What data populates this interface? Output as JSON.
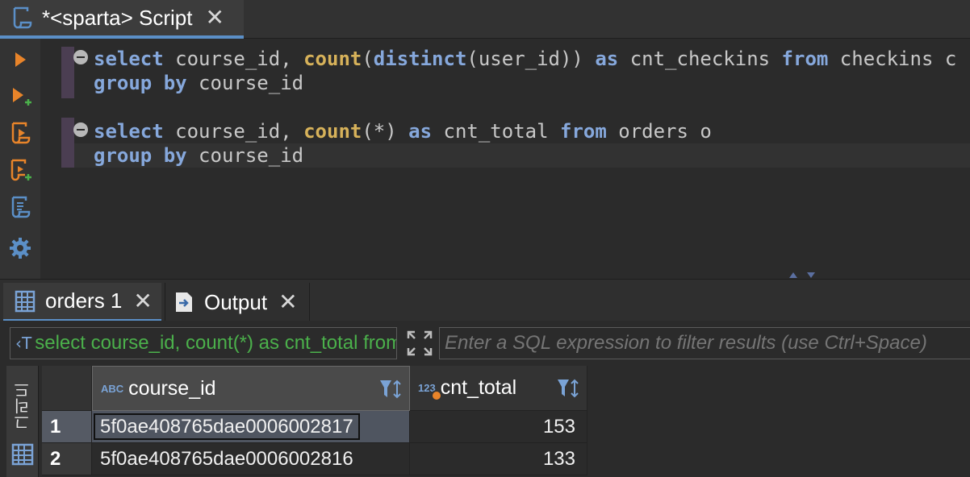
{
  "editor_tab": {
    "title": "*<sparta> Script",
    "close": "✕"
  },
  "toolbar": {
    "icons": [
      "execute-statement-icon",
      "execute-in-new-tab-icon",
      "execute-script-icon",
      "execute-script-new-tab-icon",
      "explain-plan-icon",
      "settings-icon"
    ]
  },
  "code": {
    "stmt1_line1": {
      "kw1": "select",
      "t1": " course_id, ",
      "fn1": "count",
      "t2": "(",
      "kw2": "distinct",
      "t3": "(user_id)) ",
      "kw3": "as",
      "t4": " cnt_checkins ",
      "kw4": "from",
      "t5": " checkins c"
    },
    "stmt1_line2": {
      "kw1": "group by",
      "t1": " course_id"
    },
    "stmt2_line1": {
      "kw1": "select",
      "t1": " course_id, ",
      "fn1": "count",
      "t2": "(*) ",
      "kw2": "as",
      "t3": " cnt_total ",
      "kw3": "from",
      "t4": " orders o"
    },
    "stmt2_line2": {
      "kw1": "group by",
      "t1": " course_id"
    }
  },
  "results_tabs": [
    {
      "label": "orders 1",
      "close": "✕",
      "icon": "grid-table-icon"
    },
    {
      "label": "Output",
      "close": "✕",
      "icon": "output-doc-icon"
    }
  ],
  "filter": {
    "query_icon": "‹T",
    "query_text": "select course_id, count(*) as cnt_total from orders o group by course_id",
    "placeholder": "Enter a SQL expression to filter results (use Ctrl+Space)"
  },
  "grid": {
    "side_label": "그리드",
    "columns": [
      {
        "type": "ABC",
        "name": "course_id"
      },
      {
        "type": "123",
        "name": "cnt_total"
      }
    ],
    "rows": [
      {
        "num": "1",
        "course_id": "5f0ae408765dae0006002817",
        "cnt_total": "153"
      },
      {
        "num": "2",
        "course_id": "5f0ae408765dae0006002816",
        "cnt_total": "133"
      }
    ]
  },
  "colors": {
    "accent": "#5b8fc7",
    "keyword": "#86a8dc",
    "function": "#d7b25a",
    "filter_query": "#4bb04b",
    "toolbar_orange": "#e8842a"
  }
}
